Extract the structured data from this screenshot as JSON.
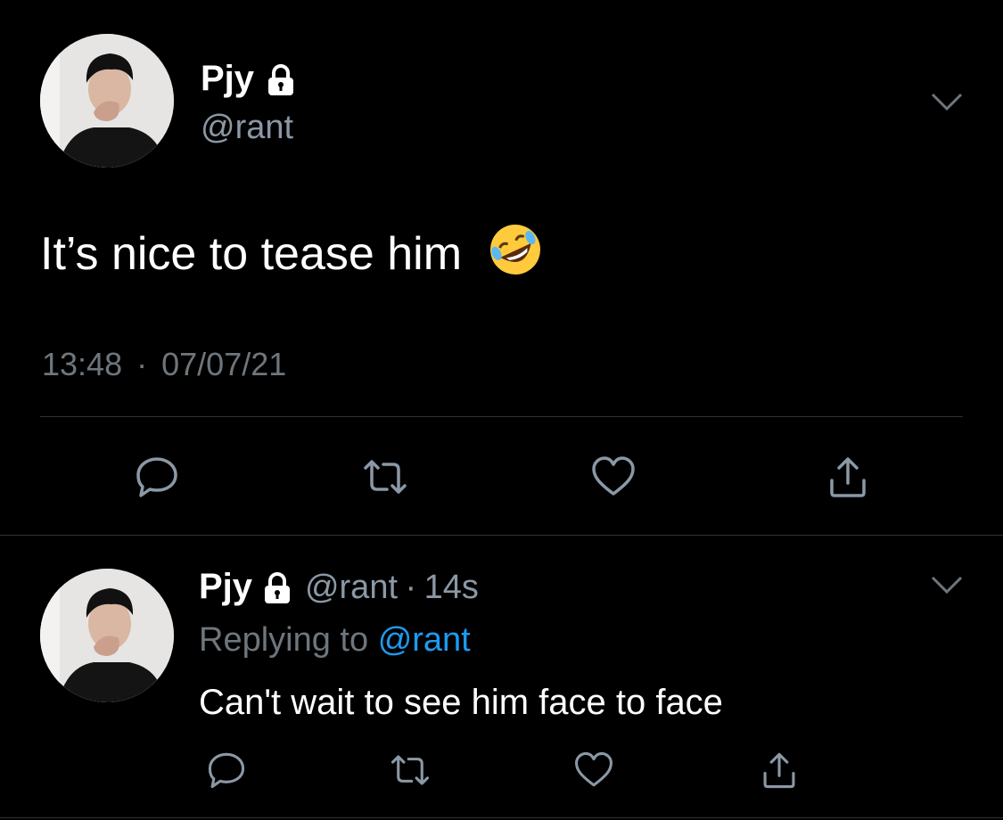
{
  "main_tweet": {
    "author_name": "Pjy",
    "author_handle": "@rant",
    "text": "It’s nice to tease him",
    "emoji_icon": "rolling-on-floor-laughing-emoji",
    "time": "13:48",
    "separator": "·",
    "date": "07/07/21"
  },
  "reply_tweet": {
    "author_name": "Pjy",
    "author_handle": "@rant",
    "separator": "·",
    "age": "14s",
    "replying_prefix": "Replying to",
    "replying_handle": "@rant",
    "text": "Can't wait to see him face to face"
  },
  "actions": [
    "reply-icon",
    "retweet-icon",
    "like-icon",
    "share-icon"
  ],
  "colors": {
    "background": "#000000",
    "text": "#ffffff",
    "secondary": "#8b98a5",
    "muted": "#6e767d",
    "accent": "#1d9bf0",
    "divider": "#2f3336"
  }
}
